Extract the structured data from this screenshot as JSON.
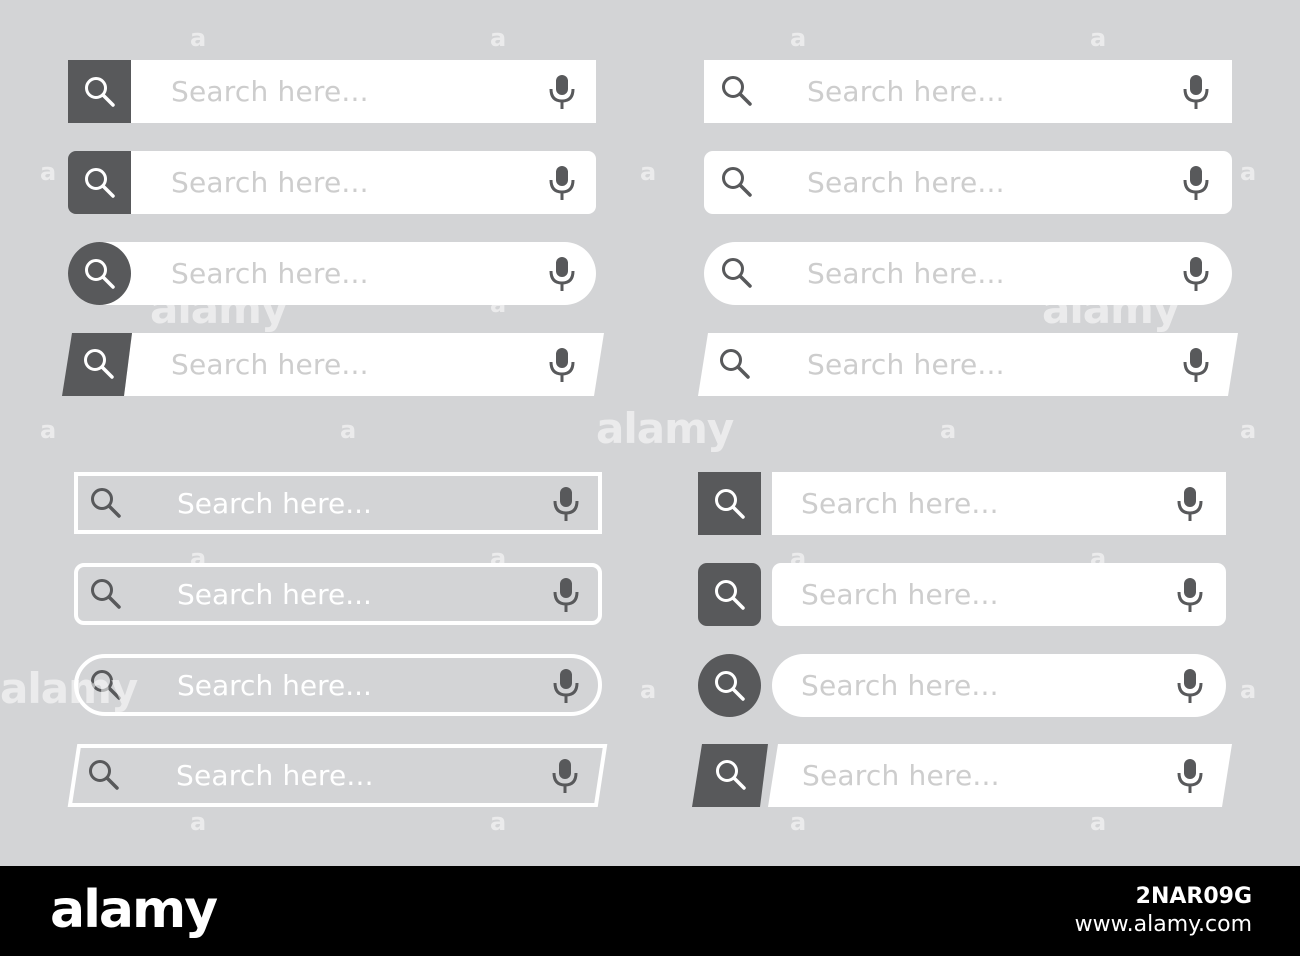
{
  "search": {
    "placeholder": "Search here..."
  },
  "icons": {
    "search": "search-icon",
    "mic": "microphone-icon"
  },
  "colors": {
    "background": "#d3d4d6",
    "bar_fill": "#ffffff",
    "button_dark": "#58595b",
    "placeholder_on_white": "#cdcdcd",
    "placeholder_on_outline": "#ffffff",
    "footer": "#000000"
  },
  "watermark": {
    "mark": "a",
    "word": "alamy"
  },
  "footer": {
    "brand": "alamy",
    "image_id": "2NAR09G",
    "site": "www.alamy.com"
  }
}
